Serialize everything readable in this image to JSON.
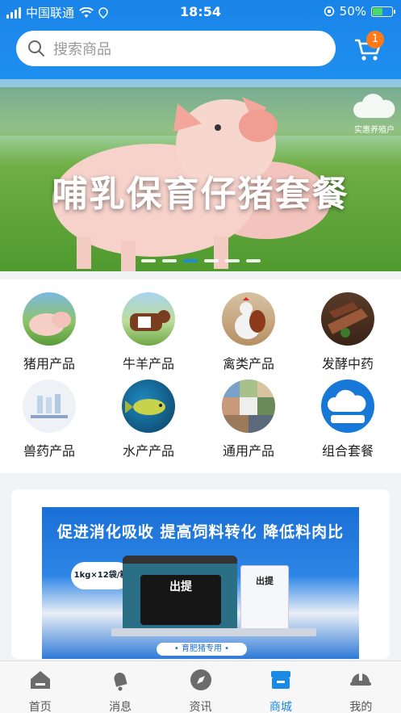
{
  "status_bar": {
    "carrier": "中国联通",
    "time": "18:54",
    "battery": "50%"
  },
  "search": {
    "placeholder": "搜索商品"
  },
  "cart": {
    "badge_count": "1"
  },
  "banner": {
    "title": "哺乳保育仔猪套餐",
    "logo_text": "实惠养殖户",
    "slide_count": 6,
    "active_slide": 3
  },
  "categories": [
    {
      "label": "猪用产品",
      "icon": "pig-photo"
    },
    {
      "label": "牛羊产品",
      "icon": "cattle-photo"
    },
    {
      "label": "禽类产品",
      "icon": "rooster-photo"
    },
    {
      "label": "发酵中药",
      "icon": "herb-photo"
    },
    {
      "label": "兽药产品",
      "icon": "vial-photo"
    },
    {
      "label": "水产产品",
      "icon": "fish-photo"
    },
    {
      "label": "通用产品",
      "icon": "collage-photo"
    },
    {
      "label": "组合套餐",
      "icon": "brand-logo"
    }
  ],
  "promo": {
    "headline": "促进消化吸收  提高饲料转化  降低料肉比",
    "pack_size": "1kg×12袋/箱",
    "product_name": "出提",
    "tag": "• 育肥猪专用 •"
  },
  "tabbar": [
    {
      "label": "首页",
      "icon": "home-icon"
    },
    {
      "label": "消息",
      "icon": "bell-icon"
    },
    {
      "label": "资讯",
      "icon": "compass-icon"
    },
    {
      "label": "商城",
      "icon": "store-icon",
      "active": true
    },
    {
      "label": "我的",
      "icon": "helmet-icon"
    }
  ],
  "colors": {
    "primary": "#1a8ae8",
    "badge": "#ff7a1a"
  }
}
